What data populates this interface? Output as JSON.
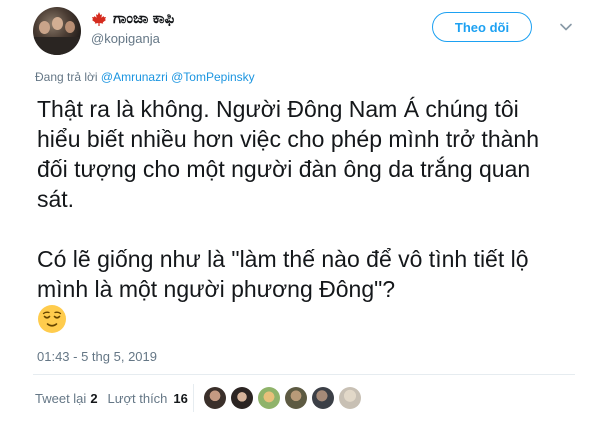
{
  "author": {
    "display_name": "ಗಾಂಜಾ ಕಾಫಿ",
    "handle": "@kopiganja"
  },
  "follow_button": {
    "label": "Theo dõi"
  },
  "reply_context": {
    "prefix": "Đang trả lời ",
    "mentions": [
      "@Amrunazri",
      "@TomPepinsky"
    ]
  },
  "tweet": {
    "paragraphs": [
      "Thật ra là không. Người Đông Nam Á chúng tôi hiểu biết nhiều hơn việc cho phép mình trở thành đối tượng cho một người đàn ông da trắng quan sát.",
      "Có lẽ giống như là \"làm thế nào để vô tình tiết lộ mình là một người phương Đông\"?"
    ],
    "emoji": "relieved-face",
    "timestamp": "01:43 - 5 thg 5, 2019"
  },
  "stats": {
    "retweets_label": "Tweet lại",
    "retweets_count": "2",
    "likes_label": "Lượt thích",
    "likes_count": "16"
  },
  "likers": [
    {
      "icon": "liker-avatar-1",
      "color": "#3a2f2a"
    },
    {
      "icon": "liker-avatar-2",
      "color": "#2b2422"
    },
    {
      "icon": "liker-avatar-3",
      "color": "#8fb36a"
    },
    {
      "icon": "liker-avatar-4",
      "color": "#5d5a42"
    },
    {
      "icon": "liker-avatar-5",
      "color": "#3b3f46"
    },
    {
      "icon": "liker-avatar-6",
      "color": "#c8c0b4"
    }
  ],
  "colors": {
    "accent": "#1da1f2",
    "mention": "#1b95e0",
    "secondary_text": "#657786",
    "primary_text": "#14171a",
    "canada_leaf": "#d52b1e"
  }
}
